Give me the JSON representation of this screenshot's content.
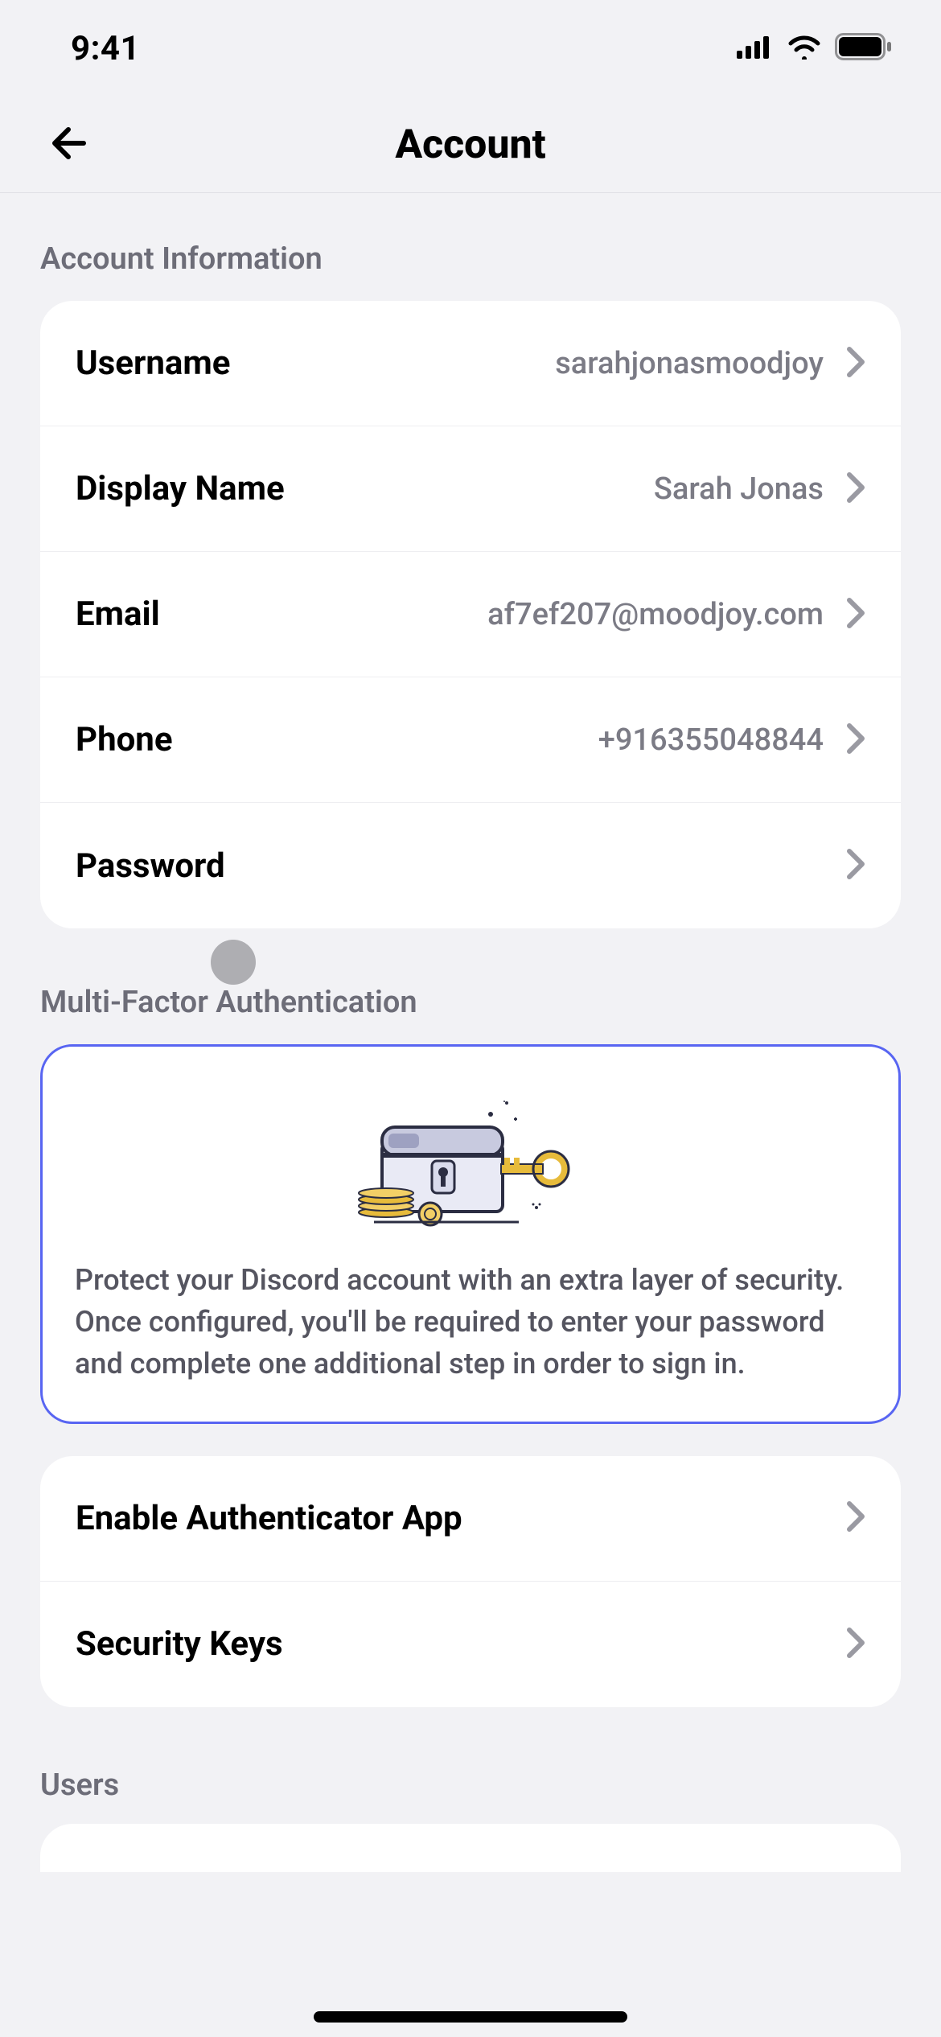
{
  "status": {
    "time": "9:41"
  },
  "header": {
    "title": "Account"
  },
  "sections": {
    "account_info": {
      "heading": "Account Information",
      "rows": {
        "username": {
          "label": "Username",
          "value": "sarahjonasmoodjoy"
        },
        "display_name": {
          "label": "Display Name",
          "value": "Sarah Jonas"
        },
        "email": {
          "label": "Email",
          "value": "af7ef207@moodjoy.com"
        },
        "phone": {
          "label": "Phone",
          "value": "+916355048844"
        },
        "password": {
          "label": "Password",
          "value": ""
        }
      }
    },
    "mfa": {
      "heading": "Multi-Factor Authentication",
      "info_text": "Protect your Discord account with an extra layer of security. Once configured, you'll be required to enter your password and complete one additional step in order to sign in.",
      "rows": {
        "authenticator": {
          "label": "Enable Authenticator App"
        },
        "security_keys": {
          "label": "Security Keys"
        }
      }
    },
    "users": {
      "heading": "Users"
    }
  },
  "colors": {
    "accent": "#5865F2",
    "bg": "#f2f2f5",
    "muted": "#6d6d78"
  }
}
